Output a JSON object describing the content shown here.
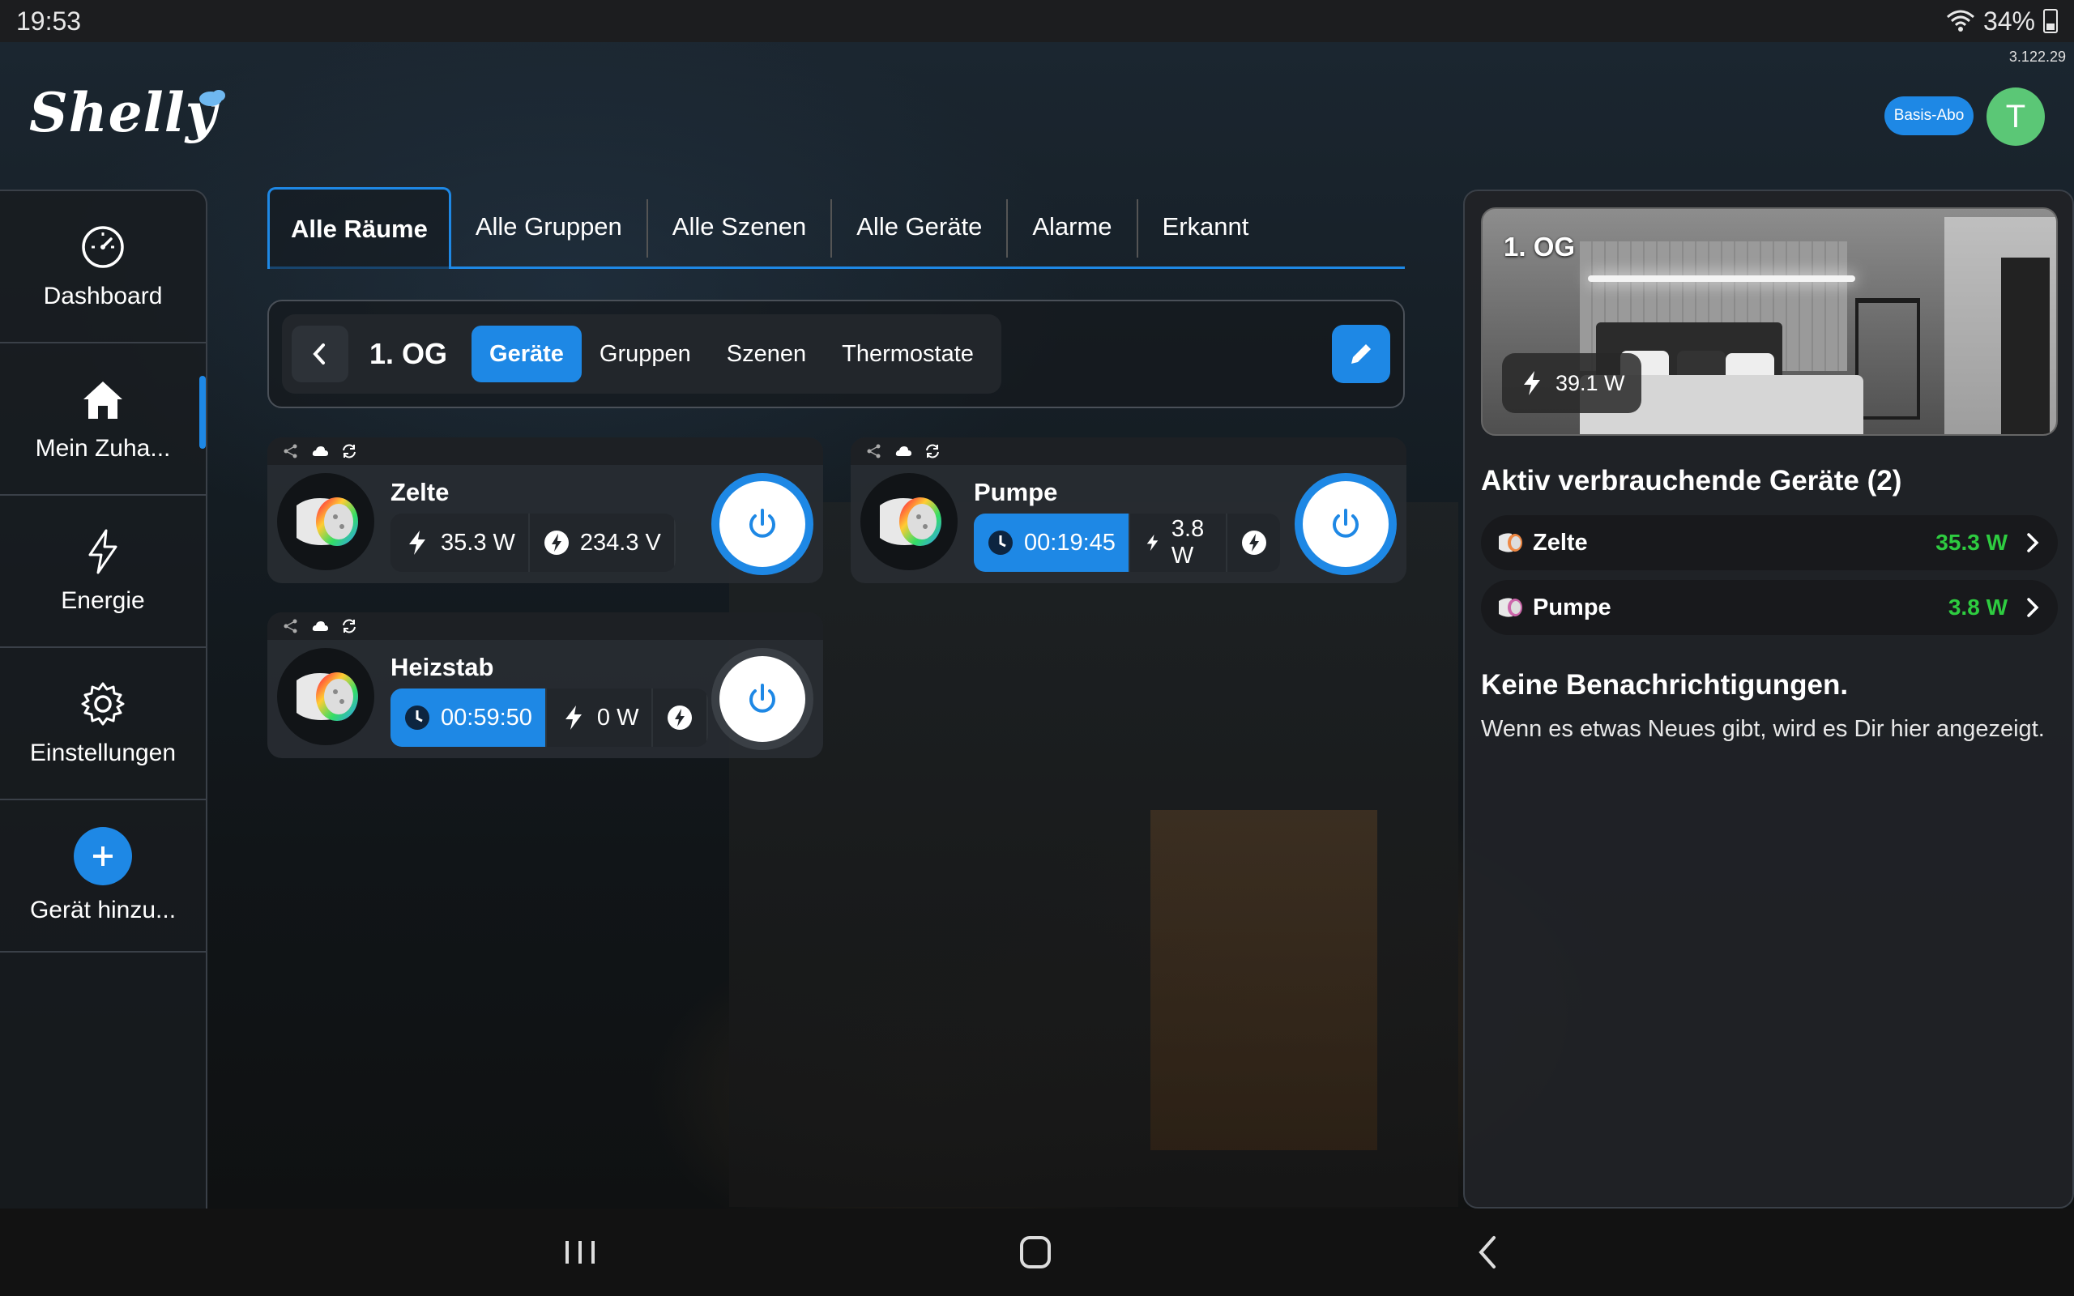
{
  "status_bar": {
    "time": "19:53",
    "battery": "34%",
    "icons": [
      "wifi-icon",
      "battery-icon"
    ]
  },
  "version": "3.122.29",
  "header": {
    "logo_text": "Shelly",
    "plan_badge": "Basis-Abo",
    "avatar_initial": "T"
  },
  "sidebar": {
    "items": [
      {
        "label": "Dashboard",
        "icon": "gauge-icon"
      },
      {
        "label": "Mein Zuha...",
        "icon": "home-icon",
        "active": true
      },
      {
        "label": "Energie",
        "icon": "lightning-icon"
      },
      {
        "label": "Einstellungen",
        "icon": "gear-icon"
      },
      {
        "label": "Gerät hinzu...",
        "icon": "plus-icon"
      }
    ]
  },
  "tabs": [
    "Alle Räume",
    "Alle Gruppen",
    "Alle Szenen",
    "Alle Geräte",
    "Alarme",
    "Erkannt"
  ],
  "active_tab": "Alle Räume",
  "room_bar": {
    "room": "1. OG",
    "subtabs": [
      "Geräte",
      "Gruppen",
      "Szenen",
      "Thermostate"
    ],
    "active_subtab": "Geräte"
  },
  "devices": [
    {
      "name": "Zelte",
      "power": "35.3 W",
      "voltage": "234.3 V",
      "state": "on"
    },
    {
      "name": "Pumpe",
      "timer": "00:19:45",
      "power": "3.8 W",
      "state": "on"
    },
    {
      "name": "Heizstab",
      "timer": "00:59:50",
      "power": "0 W",
      "state": "off"
    }
  ],
  "right_panel": {
    "room_title": "1. OG",
    "room_power": "39.1 W",
    "active_title": "Aktiv verbrauchende Geräte (2)",
    "active_devices": [
      {
        "name": "Zelte",
        "power": "35.3 W"
      },
      {
        "name": "Pumpe",
        "power": "3.8 W"
      }
    ],
    "notif_title": "Keine Benachrichtigungen.",
    "notif_text": "Wenn es etwas Neues gibt, wird es Dir hier angezeigt."
  },
  "colors": {
    "accent": "#1e88e5",
    "active_power": "#2ecc40",
    "avatar": "#5bc776"
  }
}
